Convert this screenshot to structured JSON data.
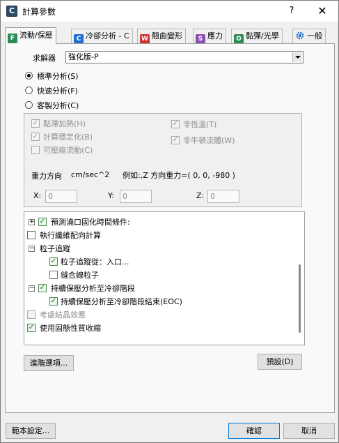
{
  "window": {
    "title": "計算參數",
    "help_label": "?",
    "close_label": "✕",
    "app_icon_letter": "C"
  },
  "tabs": [
    {
      "label": "流動/保壓",
      "icon": "F",
      "color": "#2e8b57"
    },
    {
      "label": "冷卻分析 - C",
      "icon": "C",
      "color": "#1e6fd0"
    },
    {
      "label": "翹曲變形",
      "icon": "W",
      "color": "#d03030"
    },
    {
      "label": "應力",
      "icon": "S",
      "color": "#8b4fb0"
    },
    {
      "label": "黏彈/光學",
      "icon": "O",
      "color": "#2e8b57"
    },
    {
      "label": "一般",
      "icon": "gear-icon",
      "color": "#1e6fd0"
    }
  ],
  "solver": {
    "label": "求解器",
    "value": "強化版-P"
  },
  "analysis_mode": {
    "options": [
      {
        "label": "標準分析(S)",
        "checked": true
      },
      {
        "label": "快速分析(F)",
        "checked": false
      },
      {
        "label": "客製分析(C)",
        "checked": false
      }
    ]
  },
  "options": {
    "left": [
      {
        "label": "黏滯加熱(H)",
        "checked": true,
        "enabled": false
      },
      {
        "label": "計算穩定化(B)",
        "checked": true,
        "enabled": false
      },
      {
        "label": "可壓縮流動(C)",
        "checked": false,
        "enabled": false
      }
    ],
    "right": [
      {
        "label": "非恆溫(T)",
        "checked": true,
        "enabled": false
      },
      {
        "label": "非牛頓流體(W)",
        "checked": true,
        "enabled": false
      }
    ]
  },
  "gravity": {
    "label": "重力方向",
    "unit": "cm/sec^2",
    "example": "例如:,Z 方向重力=( 0, 0, -980 )",
    "x_label": "X:",
    "x_value": "0",
    "y_label": "Y:",
    "y_value": "0",
    "z_label": "Z:",
    "z_value": "0"
  },
  "tree": [
    {
      "label": "預測澆口固化時間條件:",
      "expander": "+",
      "check": "green",
      "level": 0
    },
    {
      "label": "執行纖維配向計算",
      "expander": "",
      "check": "empty",
      "level": 0
    },
    {
      "label": "粒子追蹤",
      "expander": "−",
      "check": "none",
      "level": 0
    },
    {
      "label": "粒子追蹤從：入口...",
      "expander": "",
      "check": "green",
      "level": 1
    },
    {
      "label": "縫合線粒子",
      "expander": "",
      "check": "empty",
      "level": 1
    },
    {
      "label": "持續保壓分析至冷卻階段",
      "expander": "−",
      "check": "green",
      "level": 0
    },
    {
      "label": "持續保壓分析至冷卻階段結束(EOC)",
      "expander": "",
      "check": "green",
      "level": 1
    },
    {
      "label": "考慮結晶效應",
      "expander": "",
      "check": "empty-dis",
      "level": 0
    },
    {
      "label": "使用固態性質收縮",
      "expander": "",
      "check": "green",
      "level": 0
    }
  ],
  "buttons": {
    "advanced": "進階選項...",
    "default": "預設(D)",
    "template": "範本設定...",
    "ok": "確認",
    "cancel": "取消"
  }
}
